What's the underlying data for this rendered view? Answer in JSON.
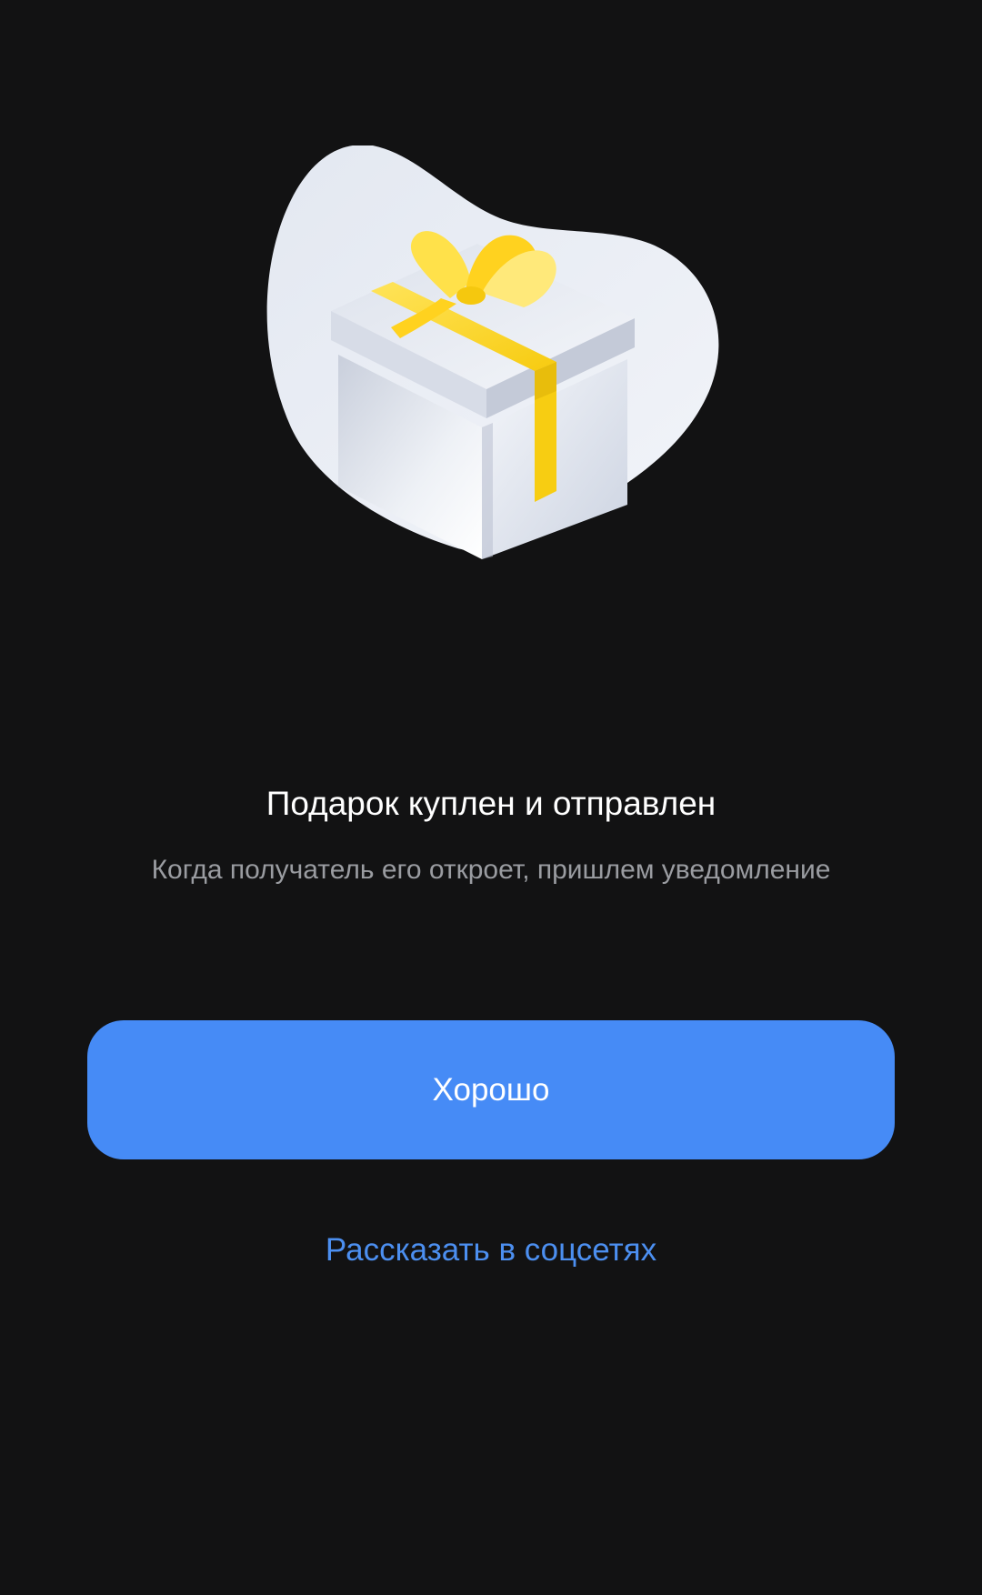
{
  "illustration": {
    "icon": "gift-box-icon",
    "colors": {
      "blob": "#e6ebf4",
      "box_light": "#f4f6fa",
      "box_shade": "#cfd5e2",
      "ribbon": "#ffd21f",
      "ribbon_light": "#ffe97a"
    }
  },
  "dialog": {
    "title": "Подарок куплен и отправлен",
    "subtitle": "Когда получатель его откроет, пришлем уведомление"
  },
  "actions": {
    "ok_label": "Хорошо",
    "share_label": "Рассказать в соцсетях"
  },
  "colors": {
    "background": "#121213",
    "accent": "#468bf6",
    "link": "#4c8ff0"
  }
}
